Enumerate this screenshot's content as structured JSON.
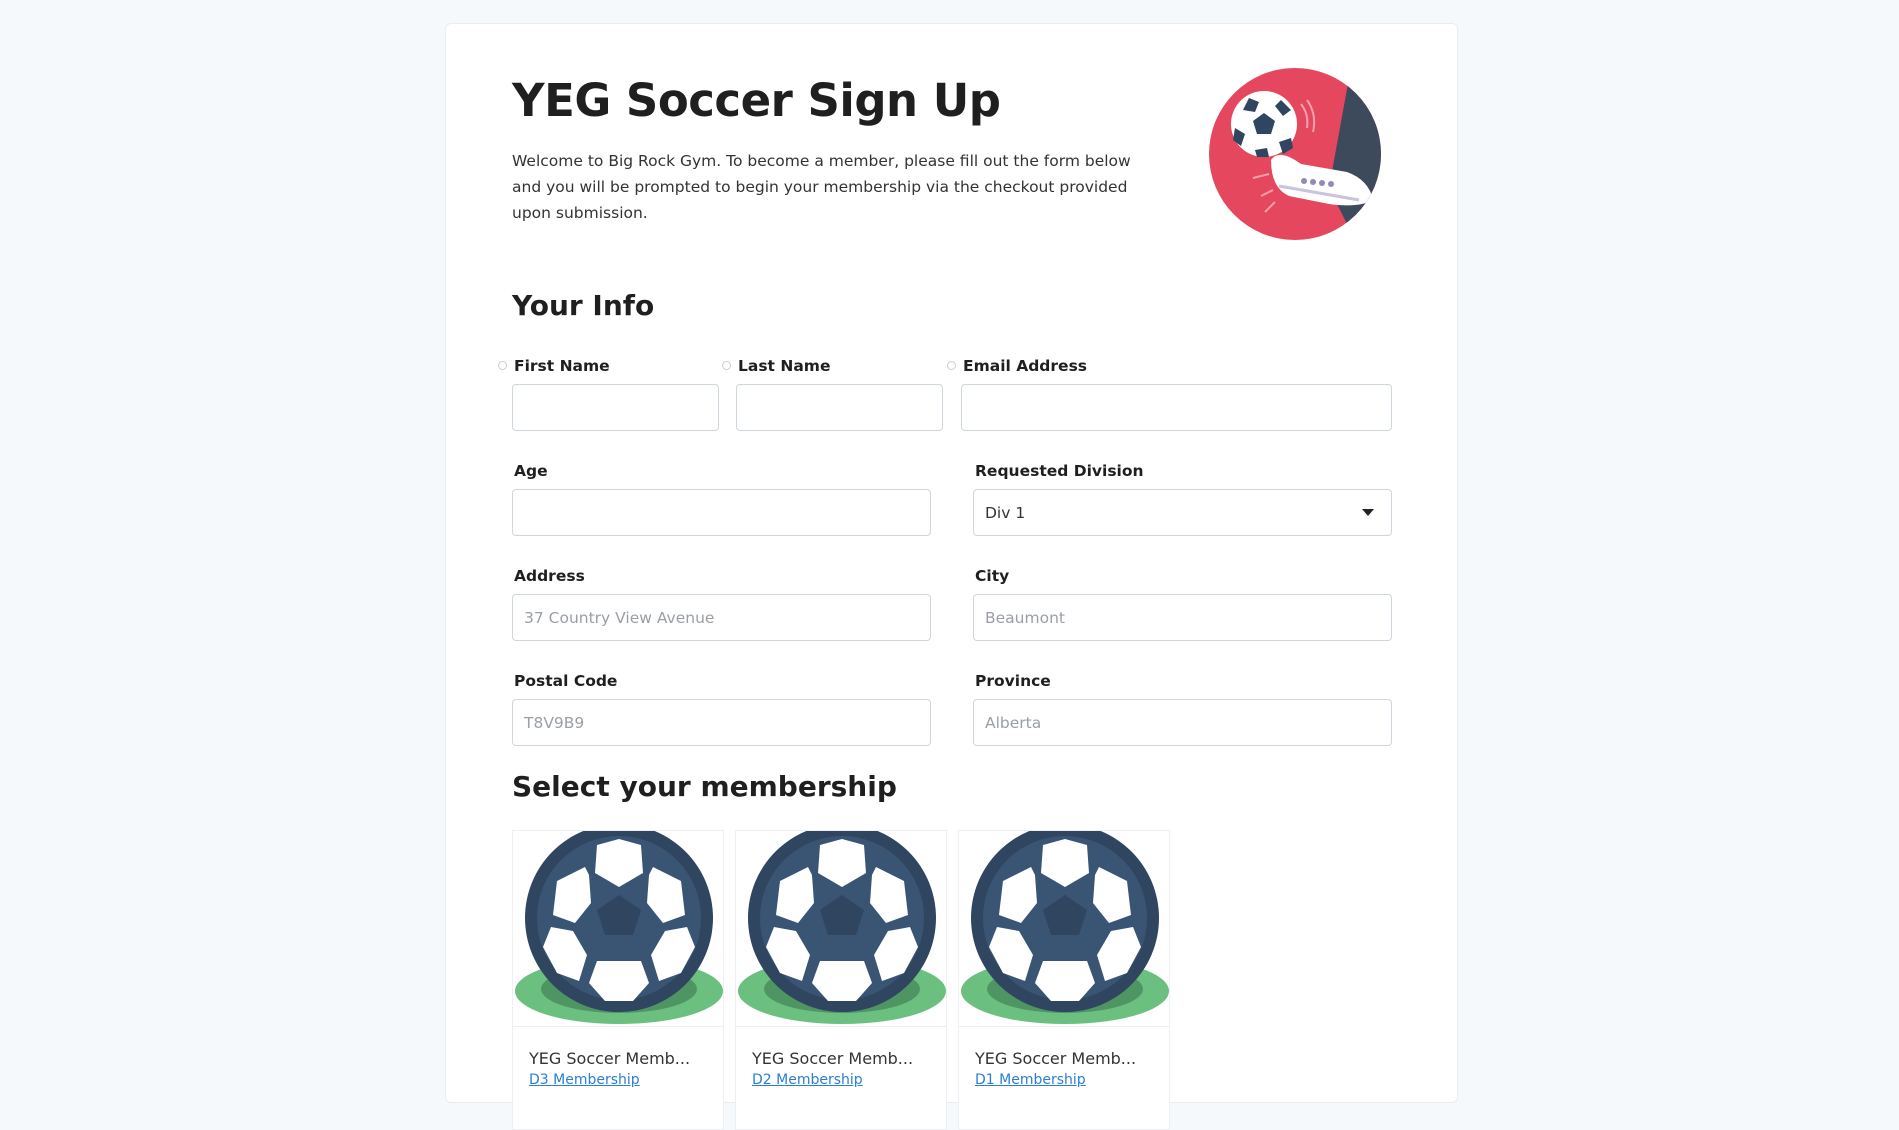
{
  "header": {
    "title": "YEG Soccer Sign Up",
    "intro": "Welcome to Big Rock Gym. To become a member, please fill out the form below and you will be prompted to begin your membership via the checkout provided upon submission."
  },
  "sections": {
    "info_title": "Your Info",
    "membership_title": "Select your membership"
  },
  "form": {
    "first_name": {
      "label": "First Name",
      "value": "",
      "placeholder": ""
    },
    "last_name": {
      "label": "Last Name",
      "value": "",
      "placeholder": ""
    },
    "email": {
      "label": "Email Address",
      "value": "",
      "placeholder": ""
    },
    "age": {
      "label": "Age",
      "value": "",
      "placeholder": ""
    },
    "division": {
      "label": "Requested Division",
      "value": "Div 1"
    },
    "address": {
      "label": "Address",
      "placeholder": "37 Country View Avenue"
    },
    "city": {
      "label": "City",
      "placeholder": "Beaumont"
    },
    "postal": {
      "label": "Postal Code",
      "placeholder": "T8V9B9"
    },
    "province": {
      "label": "Province",
      "placeholder": "Alberta"
    }
  },
  "memberships": [
    {
      "name": "YEG Soccer Memb...",
      "sub": "D3 Membership"
    },
    {
      "name": "YEG Soccer Memb...",
      "sub": "D2 Membership"
    },
    {
      "name": "YEG Soccer Memb...",
      "sub": "D1 Membership"
    }
  ],
  "colors": {
    "hero_bg": "#e5475f",
    "ball_dark": "#2f4560",
    "grass": "#6cc07f",
    "link": "#2a7fd4"
  },
  "icons": {
    "hero": "soccer-kick-illustration",
    "tile": "soccer-ball-icon",
    "select": "chevron-down-icon"
  }
}
